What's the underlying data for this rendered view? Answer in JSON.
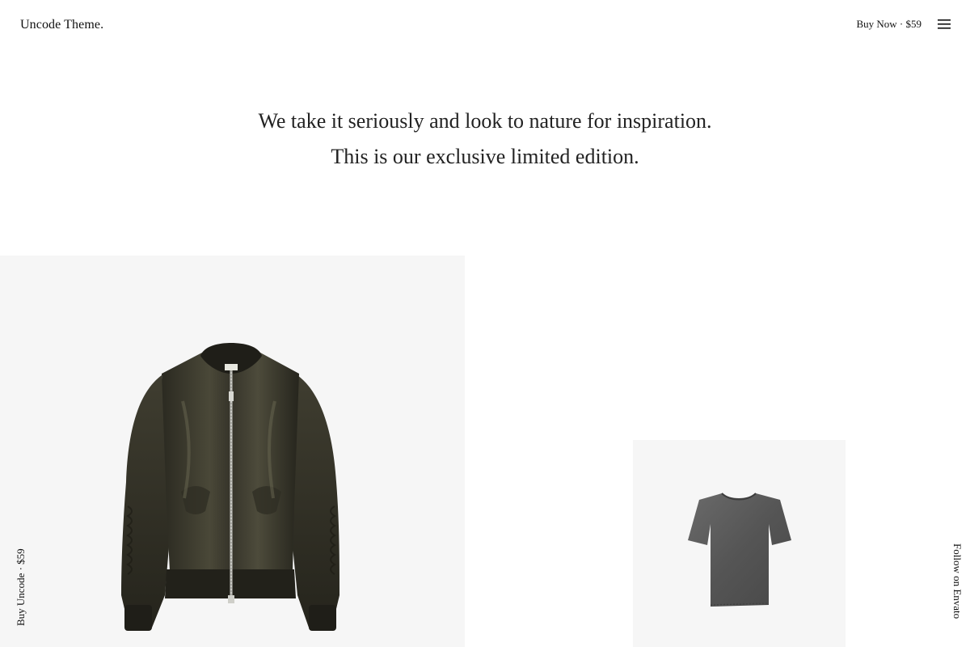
{
  "header": {
    "logo": "Uncode Theme.",
    "buy_now": "Buy Now · $59",
    "menu_icon": "hamburger-menu-icon"
  },
  "hero": {
    "line1": "We take it seriously and look to nature for inspiration.",
    "line2": "This is our exclusive limited edition."
  },
  "products": {
    "large": {
      "image": "bomber-jacket-image",
      "color": "#3b3a2e"
    },
    "small": {
      "image": "grey-tshirt-image",
      "color": "#5c5c5c"
    }
  },
  "side": {
    "left": "Buy Uncode · $59",
    "right": "Follow on Envato"
  },
  "colors": {
    "background": "#ffffff",
    "panel": "#f6f6f6",
    "text": "#111111"
  }
}
